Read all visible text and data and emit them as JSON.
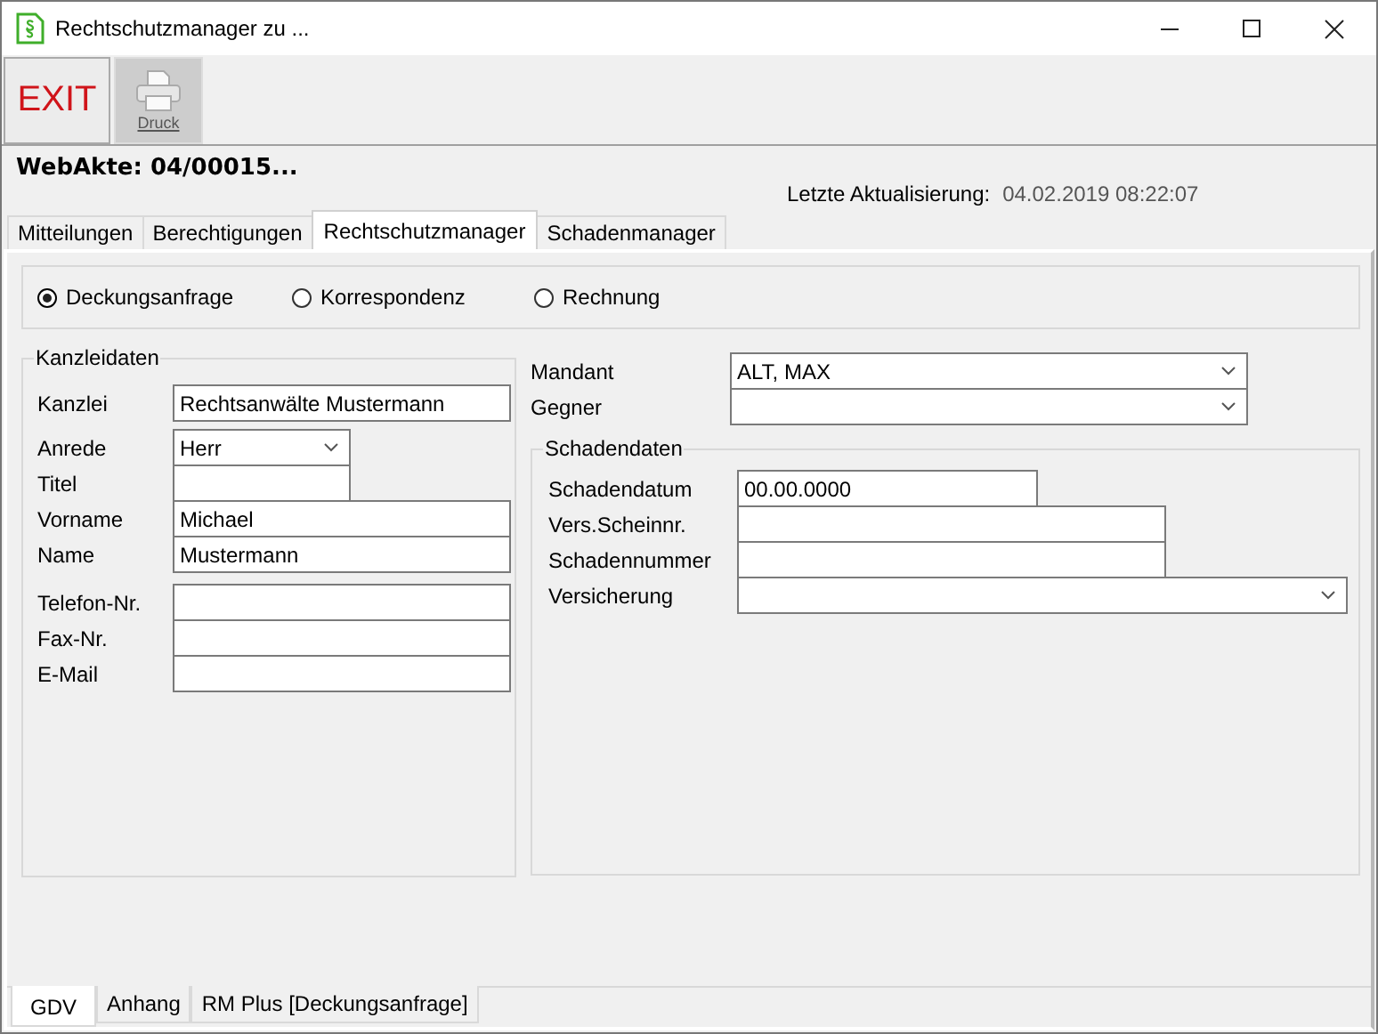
{
  "window": {
    "title": "Rechtschutzmanager zu ..."
  },
  "toolbar": [
    {
      "label": "EXIT",
      "kind": "text",
      "disabled": false
    },
    {
      "label": "Druck",
      "kind": "printer",
      "disabled": true
    }
  ],
  "header": {
    "title": "WebAkte: 04/00015...",
    "updated_label": "Letzte Aktualisierung:",
    "updated_value": "04.02.2019 08:22:07"
  },
  "tabs": [
    {
      "label": "Mitteilungen",
      "selected": false
    },
    {
      "label": "Berechtigungen",
      "selected": false
    },
    {
      "label": "Rechtschutzmanager",
      "selected": true
    },
    {
      "label": "Schadenmanager",
      "selected": false
    }
  ],
  "request_type": [
    {
      "label": "Deckungsanfrage",
      "selected": true
    },
    {
      "label": "Korrespondenz",
      "selected": false
    },
    {
      "label": "Rechnung",
      "selected": false
    }
  ],
  "kanzleidaten": {
    "title": "Kanzleidaten",
    "fields": [
      {
        "label": "Kanzlei",
        "kind": "text",
        "value": "Rechtsanwälte Mustermann"
      },
      {
        "label": "Anrede",
        "kind": "dropdown",
        "value": "Herr"
      },
      {
        "label": "Titel",
        "kind": "text"
      },
      {
        "label": "Vorname",
        "kind": "text",
        "value": "Michael"
      },
      {
        "label": "Name",
        "kind": "text",
        "value": "Mustermann"
      },
      {
        "label": "Telefon-Nr.",
        "kind": "text"
      },
      {
        "label": "Fax-Nr.",
        "kind": "text"
      },
      {
        "label": "E-Mail",
        "kind": "text"
      }
    ]
  },
  "parties": [
    {
      "label": "Mandant",
      "kind": "dropdown",
      "value": "ALT, MAX"
    },
    {
      "label": "Gegner",
      "kind": "dropdown"
    }
  ],
  "schadendaten": {
    "title": "Schadendaten",
    "fields": [
      {
        "label": "Schadendatum",
        "kind": "text",
        "value": "00.00.0000"
      },
      {
        "label": "Vers.Scheinnr.",
        "kind": "text"
      },
      {
        "label": "Schadennummer",
        "kind": "text"
      },
      {
        "label": "Versicherung",
        "kind": "dropdown"
      }
    ]
  },
  "bottom_tabs": [
    {
      "label": "GDV",
      "selected": true
    },
    {
      "label": "Anhang",
      "selected": false
    },
    {
      "label": "RM Plus [Deckungsanfrage]",
      "selected": false
    }
  ]
}
